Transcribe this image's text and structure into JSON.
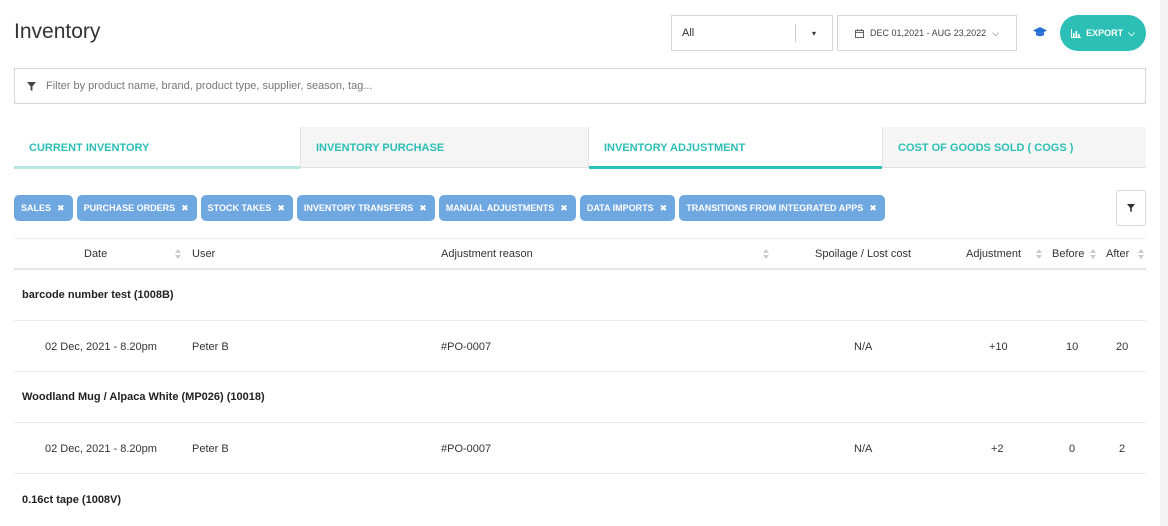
{
  "page": {
    "title": "Inventory"
  },
  "location_select": {
    "value": "All",
    "caret": "▾"
  },
  "date_range": {
    "label": "DEC 01,2021 - AUG 23,2022",
    "chevron": "⌵"
  },
  "export": {
    "label": "EXPORT",
    "chevron": "⌵"
  },
  "filter": {
    "placeholder": "Filter by product name, brand, product type, supplier, season, tag..."
  },
  "tabs": [
    {
      "label": "CURRENT INVENTORY"
    },
    {
      "label": "INVENTORY PURCHASE"
    },
    {
      "label": "INVENTORY ADJUSTMENT"
    },
    {
      "label": "COST OF GOODS SOLD ( COGS )"
    }
  ],
  "chips": [
    {
      "label": "SALES"
    },
    {
      "label": "PURCHASE ORDERS"
    },
    {
      "label": "STOCK TAKES"
    },
    {
      "label": "INVENTORY TRANSFERS"
    },
    {
      "label": "MANUAL ADJUSTMENTS"
    },
    {
      "label": "DATA IMPORTS"
    },
    {
      "label": "TRANSITIONS FROM INTEGRATED APPS"
    }
  ],
  "chip_remove": "✖",
  "table": {
    "headers": {
      "date": "Date",
      "user": "User",
      "reason": "Adjustment reason",
      "spoilage": "Spoilage / Lost cost",
      "adjustment": "Adjustment",
      "before": "Before",
      "after": "After"
    },
    "groups": [
      {
        "product": "barcode number test (1008B)",
        "rows": [
          {
            "date": "02 Dec, 2021 - 8.20pm",
            "user": "Peter B",
            "reason": "#PO-0007",
            "spoilage": "N/A",
            "adjustment": "+10",
            "before": "10",
            "after": "20"
          }
        ]
      },
      {
        "product": "Woodland Mug / Alpaca White (MP026) (10018)",
        "rows": [
          {
            "date": "02 Dec, 2021 - 8.20pm",
            "user": "Peter B",
            "reason": "#PO-0007",
            "spoilage": "N/A",
            "adjustment": "+2",
            "before": "0",
            "after": "2"
          }
        ]
      },
      {
        "product": "0.16ct tape (1008V)",
        "rows": []
      }
    ]
  },
  "colors": {
    "accent": "#2bbfb6",
    "chip": "#6fa7e0",
    "icon_blue": "#2a6fd6"
  }
}
